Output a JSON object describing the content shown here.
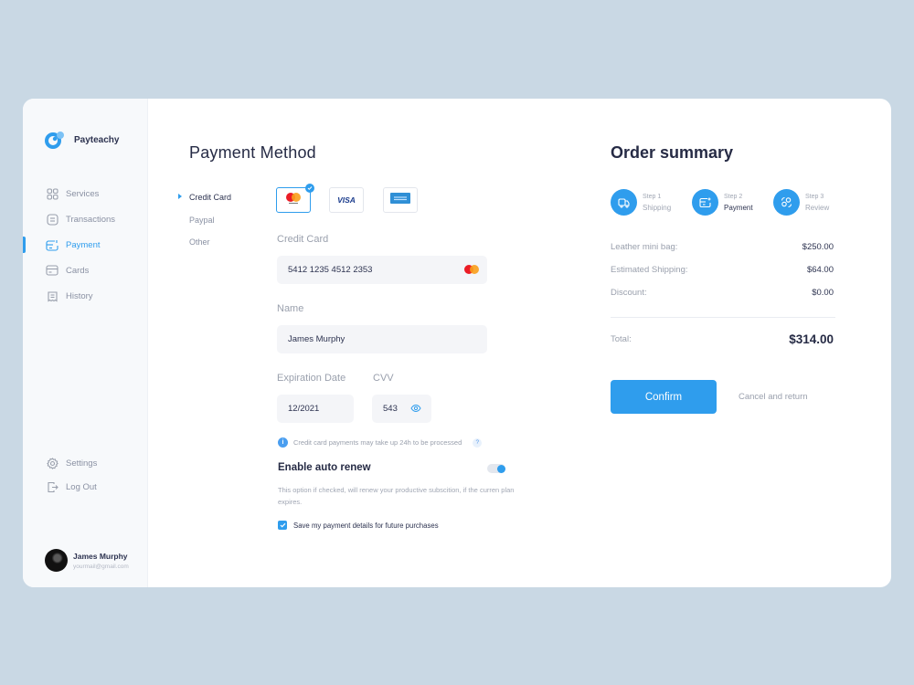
{
  "app": {
    "name": "Payteachy"
  },
  "sidebar": {
    "items": [
      {
        "label": "Services",
        "icon": "grid-icon",
        "active": false
      },
      {
        "label": "Transactions",
        "icon": "list-icon",
        "active": false
      },
      {
        "label": "Payment",
        "icon": "payment-icon",
        "active": true
      },
      {
        "label": "Cards",
        "icon": "card-icon",
        "active": false
      },
      {
        "label": "History",
        "icon": "history-icon",
        "active": false
      }
    ],
    "bottom_items": [
      {
        "label": "Settings",
        "icon": "gear-icon"
      },
      {
        "label": "Log Out",
        "icon": "logout-icon"
      }
    ],
    "user": {
      "name": "James Murphy",
      "email": "yourmail@gmail.com"
    }
  },
  "payment": {
    "title": "Payment Method",
    "methods": [
      {
        "label": "Credit Card",
        "active": true
      },
      {
        "label": "Paypal",
        "active": false
      },
      {
        "label": "Other",
        "active": false
      }
    ],
    "card_brands": [
      {
        "name": "mastercard",
        "selected": true
      },
      {
        "name": "visa",
        "label": "VISA",
        "selected": false
      },
      {
        "name": "amex",
        "selected": false
      }
    ],
    "credit_card_label": "Credit Card",
    "credit_card_value": "5412 1235 4512 2353",
    "name_label": "Name",
    "name_value": "James Murphy",
    "expiration_label": "Expiration Date",
    "expiration_value": "12/2021",
    "cvv_label": "CVV",
    "cvv_value": "543",
    "info_text": "Credit card payments may take up 24h to be processed",
    "info_icon": "i",
    "help_icon": "?",
    "auto_renew_title": "Enable auto renew",
    "auto_renew_enabled": true,
    "auto_renew_desc": "This option if checked, will renew your productive subscition, if the curren plan expires.",
    "save_details_label": "Save my payment details for future purchases",
    "save_details_checked": true
  },
  "summary": {
    "title": "Order summary",
    "steps": [
      {
        "num": "Step 1",
        "label": "Shipping",
        "current": false
      },
      {
        "num": "Step 2",
        "label": "Payment",
        "current": true
      },
      {
        "num": "Step 3",
        "label": "Review",
        "current": false
      }
    ],
    "rows": [
      {
        "label": "Leather mini bag:",
        "value": "$250.00"
      },
      {
        "label": "Estimated Shipping:",
        "value": "$64.00"
      },
      {
        "label": "Discount:",
        "value": "$0.00"
      }
    ],
    "total_label": "Total:",
    "total_value": "$314.00",
    "confirm_label": "Confirm",
    "cancel_label": "Cancel and return"
  },
  "colors": {
    "accent": "#2f9ded",
    "background": "#c9d8e4"
  }
}
